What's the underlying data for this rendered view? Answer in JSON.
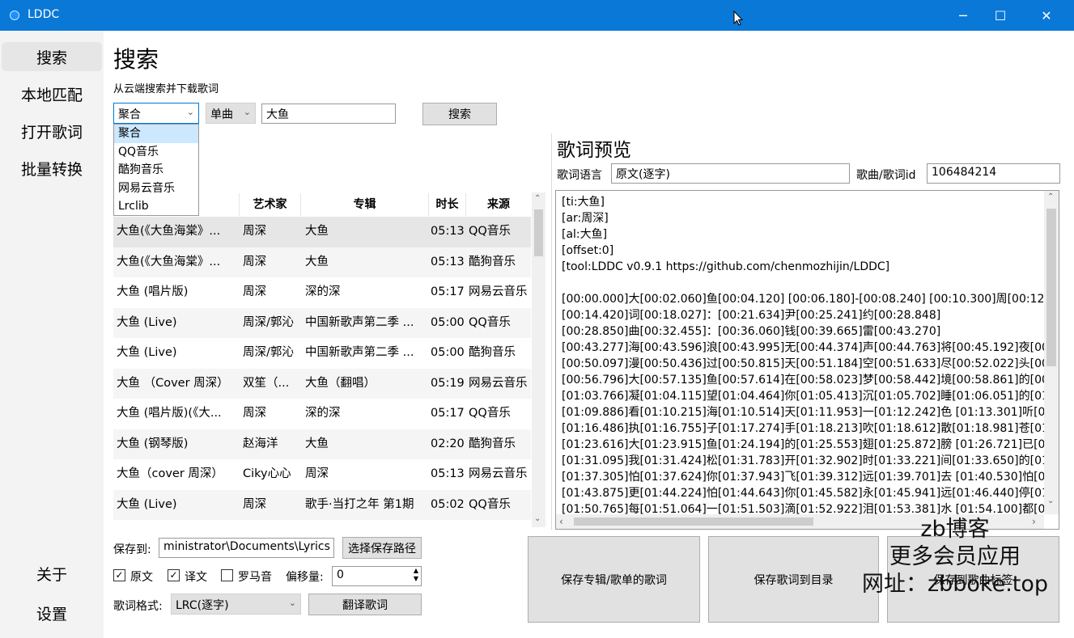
{
  "window": {
    "title": "LDDC",
    "min": "─",
    "max": "☐",
    "close": "✕"
  },
  "sidebar": {
    "items": [
      {
        "label": "搜索",
        "active": true
      },
      {
        "label": "本地匹配"
      },
      {
        "label": "打开歌词"
      },
      {
        "label": "批量转换"
      }
    ],
    "bottom": [
      {
        "label": "关于"
      },
      {
        "label": "设置"
      }
    ]
  },
  "search": {
    "title": "搜索",
    "subtitle": "从云端搜索并下载歌词",
    "source_value": "聚合",
    "source_options": [
      "聚合",
      "QQ音乐",
      "酷狗音乐",
      "网易云音乐",
      "Lrclib"
    ],
    "type_value": "单曲",
    "query": "大鱼",
    "search_button": "搜索"
  },
  "results": {
    "columns": [
      "",
      "艺术家",
      "专辑",
      "时长",
      "来源"
    ],
    "rows": [
      [
        "大鱼(《大鱼海棠》...",
        "周深",
        "大鱼",
        "05:13",
        "QQ音乐"
      ],
      [
        "大鱼(《大鱼海棠》...",
        "周深",
        "大鱼",
        "05:13",
        "酷狗音乐"
      ],
      [
        "大鱼 (唱片版)",
        "周深",
        "深的深",
        "05:17",
        "网易云音乐"
      ],
      [
        "大鱼 (Live)",
        "周深/郭沁",
        "中国新歌声第二季 ...",
        "05:00",
        "QQ音乐"
      ],
      [
        "大鱼 (Live)",
        "周深/郭沁",
        "中国新歌声第二季 ...",
        "05:00",
        "酷狗音乐"
      ],
      [
        "大鱼 （Cover 周深）",
        "双笙（...",
        "大鱼（翻唱）",
        "05:19",
        "网易云音乐"
      ],
      [
        "大鱼 (唱片版)(《大...",
        "周深",
        "深的深",
        "05:17",
        "QQ音乐"
      ],
      [
        "大鱼 (钢琴版)",
        "赵海洋",
        "大鱼",
        "02:20",
        "酷狗音乐"
      ],
      [
        "大鱼（cover 周深）",
        "Ciky心心",
        "周深",
        "05:13",
        "网易云音乐"
      ],
      [
        "大鱼 (Live)",
        "周深",
        "歌手·当打之年 第1期",
        "05:02",
        "QQ音乐"
      ]
    ]
  },
  "preview": {
    "title": "歌词预览",
    "lang_label": "歌词语言",
    "lang_value": "原文(逐字)",
    "id_label": "歌曲/歌词id",
    "id_value": "106484214",
    "lines": [
      "[ti:大鱼]",
      "[ar:周深]",
      "[al:大鱼]",
      "[offset:0]",
      "[tool:LDDC v0.9.1 https://github.com/chenmozhijin/LDDC]",
      "",
      "[00:00.000]大[00:02.060]鱼[00:04.120] [00:06.180]-[00:08.240] [00:10.300]周[00:12.36",
      "[00:14.420]词[00:18.027]：[00:21.634]尹[00:25.241]约[00:28.848]",
      "[00:28.850]曲[00:32.455]：[00:36.060]钱[00:39.665]雷[00:43.270]",
      "[00:43.277]海[00:43.596]浪[00:43.995]无[00:44.374]声[00:44.763]将[00:45.192]夜[00:4",
      "[00:50.097]漫[00:50.436]过[00:50.815]天[00:51.184]空[00:51.633]尽[00:52.022]头[00:5",
      "[00:56.796]大[00:57.135]鱼[00:57.614]在[00:58.023]梦[00:58.442]境[00:58.861]的[00:5",
      "[01:03.766]凝[01:04.115]望[01:04.464]你[01:05.413]沉[01:05.702]睡[01:06.051]的[01:0",
      "[01:09.886]看[01:10.215]海[01:10.514]天[01:11.953]一[01:12.242]色 [01:13.301]听[01:",
      "[01:16.486]执[01:16.755]子[01:17.274]手[01:18.213]吹[01:18.612]散[01:18.981]苍[01:1",
      "[01:23.616]大[01:23.915]鱼[01:24.194]的[01:25.553]翅[01:25.872]膀 [01:26.721]已[01:",
      "[01:31.095]我[01:31.424]松[01:31.783]开[01:32.902]时[01:33.221]间[01:33.650]的[01:3",
      "[01:37.305]怕[01:37.624]你[01:37.943]飞[01:39.312]远[01:39.701]去 [01:40.530]怕[01:",
      "[01:43.875]更[01:44.224]怕[01:44.643]你[01:45.582]永[01:45.941]远[01:46.440]停[01:4",
      "[01:50.765]每[01:51.064]一[01:51.503]滴[01:52.922]泪[01:53.381]水 [01:54.100]都[01:"
    ]
  },
  "bottom": {
    "save_to_label": "保存到:",
    "save_path": "ministrator\\Documents\\Lyrics",
    "choose_path_button": "选择保存路径",
    "cb_original": "原文",
    "cb_translation": "译文",
    "cb_romaji": "罗马音",
    "offset_label": "偏移量:",
    "offset_value": "0",
    "format_label": "歌词格式:",
    "format_value": "LRC(逐字)",
    "translate_button": "翻译歌词",
    "save_album_button": "保存专辑/歌单的歌词",
    "save_to_dir_button": "保存歌词到目录",
    "save_to_tag_button": "保存到歌曲标签"
  },
  "watermark": {
    "line1": "zb博客",
    "line2": "更多会员应用",
    "line3": "网址：zbboke.top"
  }
}
